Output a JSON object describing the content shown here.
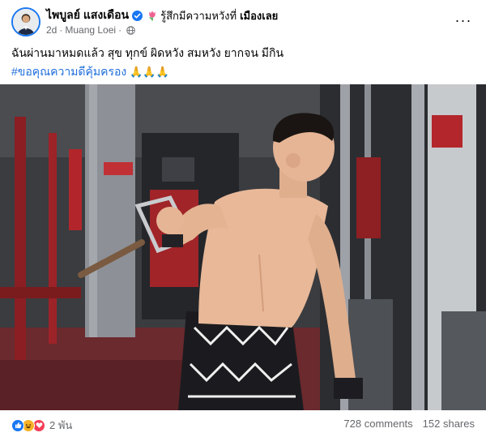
{
  "post": {
    "author_name": "ไพบูลย์ แสงเดือน",
    "feeling_text": "รู้สึกมีความหวังที่",
    "feeling_place": "เมืองเลย",
    "timestamp": "2d",
    "location": "Muang Loei",
    "meta_separator": "·",
    "more_label": "···",
    "text": "ฉันผ่านมาหมดแล้ว สุข ทุกข์ ผิดหวัง สมหวัง ยากจน มีกิน",
    "hashtag": "#ขอคุณความดีคุ้มครอง",
    "hashtag_emoji": "🙏🙏🙏"
  },
  "footer": {
    "reaction_count": "2 พัน",
    "comments": "728 comments",
    "shares": "152 shares"
  },
  "icons": {
    "verified": "verified-badge-icon",
    "feeling": "tulip-emoji-icon",
    "privacy": "globe-icon",
    "reactions": [
      "like-icon",
      "haha-icon",
      "love-icon"
    ]
  },
  "colors": {
    "verified_blue": "#1877f2",
    "hashtag_blue": "#216fdb",
    "secondary_text": "#65676b",
    "like_blue": "#1877f2",
    "haha_yellow": "#f7b125",
    "love_red": "#f33e58"
  }
}
